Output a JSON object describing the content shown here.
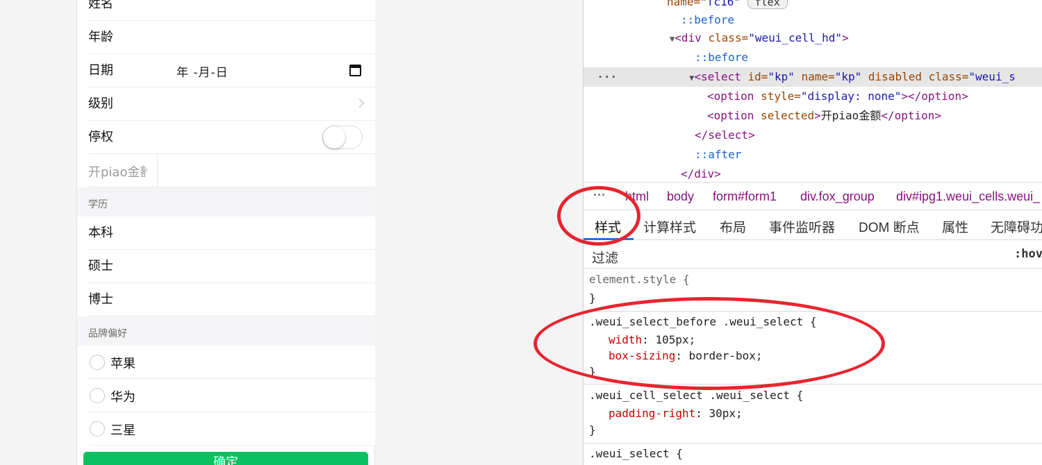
{
  "form": {
    "name_label": "姓名",
    "age_label": "年龄",
    "date_label": "日期",
    "date_value": "年 -月-日",
    "level_label": "级别",
    "suspend_label": "停权",
    "suspend_on": false,
    "invoice_label": "开piao金额",
    "education_title": "学历",
    "education_options": [
      "本科",
      "硕士",
      "博士"
    ],
    "brand_title": "品牌偏好",
    "brand_options": [
      "苹果",
      "华为",
      "三星"
    ],
    "confirm_label": "确定"
  },
  "devtools": {
    "dom": {
      "l0_attr": "name=",
      "l0_val": "\"fc16\"",
      "l0_badge": "flex",
      "l1": "::before",
      "l2_tag": "<div",
      "l2_attr": "class=",
      "l2_val": "\"weui_cell_hd\"",
      "l2_end": ">",
      "l3": "::before",
      "l4_tag": "<select",
      "l4_a1": "id=",
      "l4_v1": "\"kp\"",
      "l4_a2": "name=",
      "l4_v2": "\"kp\"",
      "l4_a3": "disabled",
      "l4_a4": "class=",
      "l4_v4": "\"weui_s",
      "l5_tag": "<option",
      "l5_attr": "style=",
      "l5_val": "\"display: none\"",
      "l5_end": "></option>",
      "l6_tag": "<option",
      "l6_attr": "selected",
      "l6_txt": "开piao金额",
      "l6_end": "</option>",
      "l7": "</select>",
      "l8": "::after",
      "l9": "</div>"
    },
    "breadcrumbs": [
      "html",
      "body",
      "form#form1",
      "div.fox_group",
      "div#ipg1.weui_cells.weui_"
    ],
    "tabs": [
      "样式",
      "计算样式",
      "布局",
      "事件监听器",
      "DOM 断点",
      "属性",
      "无障碍功"
    ],
    "filter_placeholder": "过滤",
    "hov_label": ":hov",
    "rules": {
      "element_style": "element.style {",
      "close": "}",
      "r1_selector": ".weui_select_before .weui_select {",
      "r1_p1": "width",
      "r1_v1": "105px;",
      "r1_p2": "box-sizing",
      "r1_v2": "border-box;",
      "r2_selector": ".weui_cell_select .weui_select {",
      "r2_p1": "padding-right",
      "r2_v1": "30px;",
      "r3_selector": ".weui_select {"
    }
  },
  "colors": {
    "primary_green": "#07c160",
    "annotation_red": "#e8252f",
    "active_tab_blue": "#1a73e8"
  }
}
